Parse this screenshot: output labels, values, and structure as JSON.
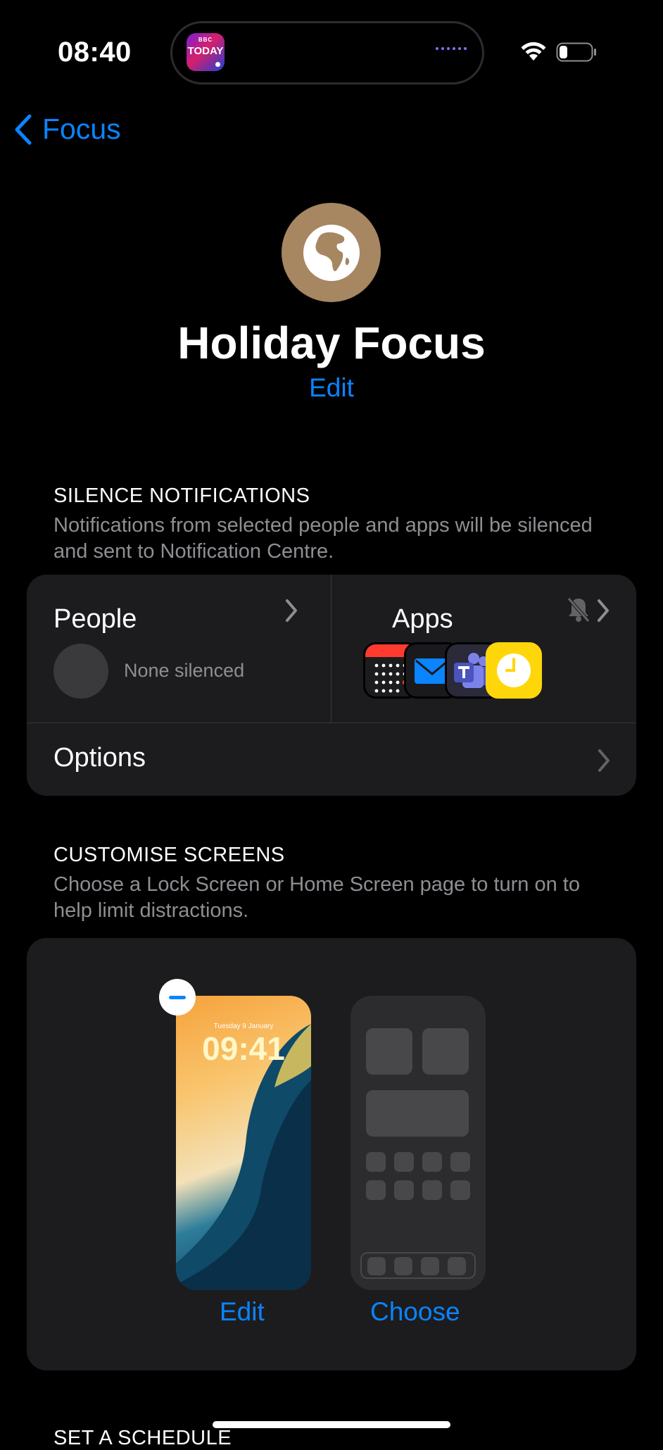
{
  "status_bar": {
    "time": "08:40",
    "live_activity": {
      "app_name": "TODAY",
      "brand": "BBC"
    }
  },
  "nav": {
    "back_label": "Focus"
  },
  "focus": {
    "icon": "globe-africa-icon",
    "icon_color": "#a78662",
    "title": "Holiday Focus",
    "edit_label": "Edit"
  },
  "silence": {
    "header": "SILENCE NOTIFICATIONS",
    "description": "Notifications from selected people and apps will be silenced and sent to Notification Centre.",
    "people_label": "People",
    "people_status": "None silenced",
    "apps_label": "Apps",
    "apps": [
      "calendar-app-icon",
      "mail-app-icon",
      "teams-app-icon",
      "clock-app-icon"
    ],
    "options_label": "Options"
  },
  "customise": {
    "header": "CUSTOMISE SCREENS",
    "description": "Choose a Lock Screen or Home Screen page to turn on to help limit distractions.",
    "lock_date": "Tuesday 9 January",
    "lock_time": "09:41",
    "edit_label": "Edit",
    "choose_label": "Choose"
  },
  "schedule": {
    "header": "SET A SCHEDULE"
  },
  "colors": {
    "accent": "#0a84ff",
    "background": "#000000",
    "card": "#1c1c1e"
  }
}
